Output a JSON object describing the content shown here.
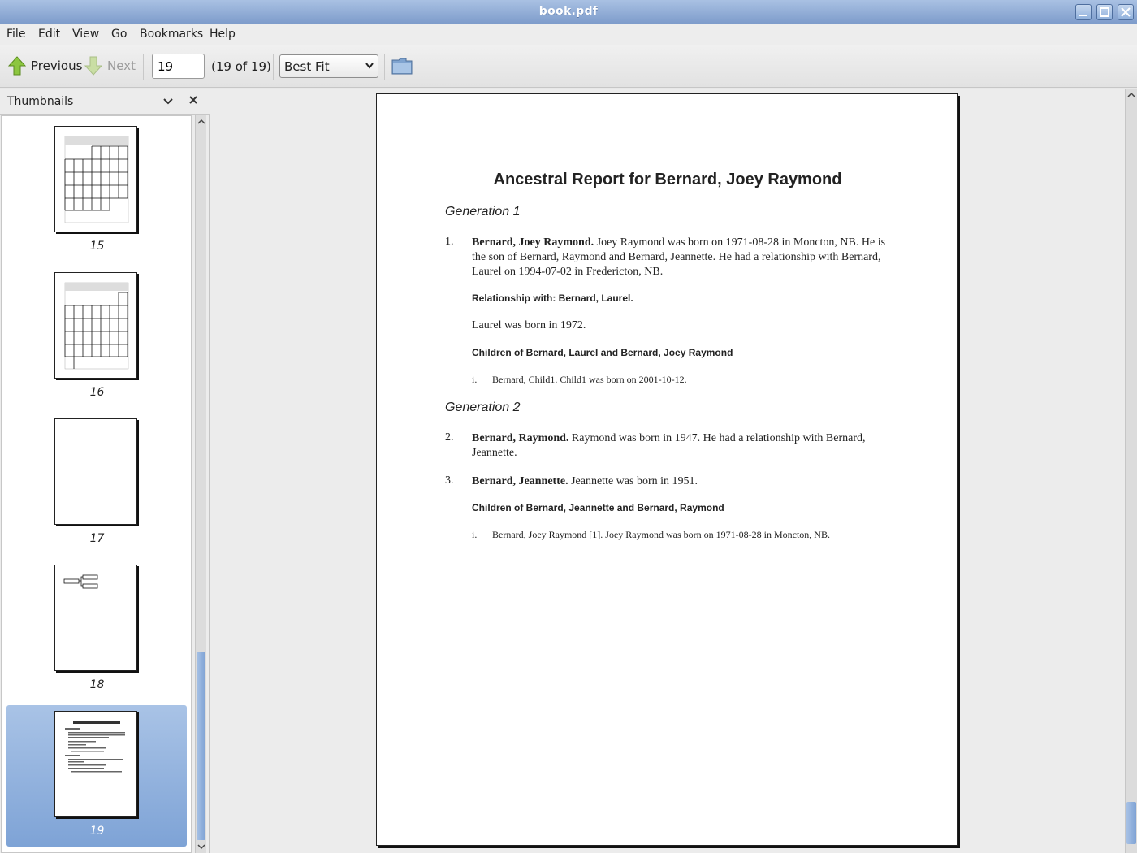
{
  "window": {
    "title": "book.pdf"
  },
  "menu": [
    "File",
    "Edit",
    "View",
    "Go",
    "Bookmarks",
    "Help"
  ],
  "toolbar": {
    "previous_label": "Previous",
    "next_label": "Next",
    "page_value": "19",
    "page_count": "(19 of 19)",
    "zoom_value": "Best Fit"
  },
  "sidebar": {
    "title": "Thumbnails",
    "thumbnails": [
      {
        "label": "15"
      },
      {
        "label": "16"
      },
      {
        "label": "17"
      },
      {
        "label": "18"
      },
      {
        "label": "19"
      }
    ]
  },
  "document": {
    "title": "Ancestral Report for Bernard, Joey Raymond",
    "gen1": "Generation 1",
    "e1_num": "1.",
    "e1_name": "Bernard, Joey Raymond.",
    "e1_text": " Joey Raymond was born on 1971-08-28 in Moncton, NB.  He is the son of Bernard, Raymond and Bernard, Jeannette. He had a relationship with Bernard, Laurel on 1994-07-02 in Fredericton, NB.",
    "rel_head": "Relationship with: Bernard, Laurel.",
    "rel_text": "Laurel was born in 1972.",
    "children1_head": "Children of Bernard, Laurel and Bernard, Joey Raymond",
    "child1_num": "i.",
    "child1_text": "Bernard, Child1. Child1 was born on 2001-10-12.",
    "gen2": "Generation 2",
    "e2_num": "2.",
    "e2_name": "Bernard, Raymond.",
    "e2_text": " Raymond was born in 1947.  He had a relationship with Bernard, Jeannette.",
    "e3_num": "3.",
    "e3_name": "Bernard, Jeannette.",
    "e3_text": " Jeannette was born in 1951.",
    "children2_head": "Children of Bernard, Jeannette and Bernard, Raymond",
    "child2_num": "i.",
    "child2_text": "Bernard, Joey Raymond [1]. Joey Raymond was born on 1971-08-28 in Moncton, NB."
  }
}
